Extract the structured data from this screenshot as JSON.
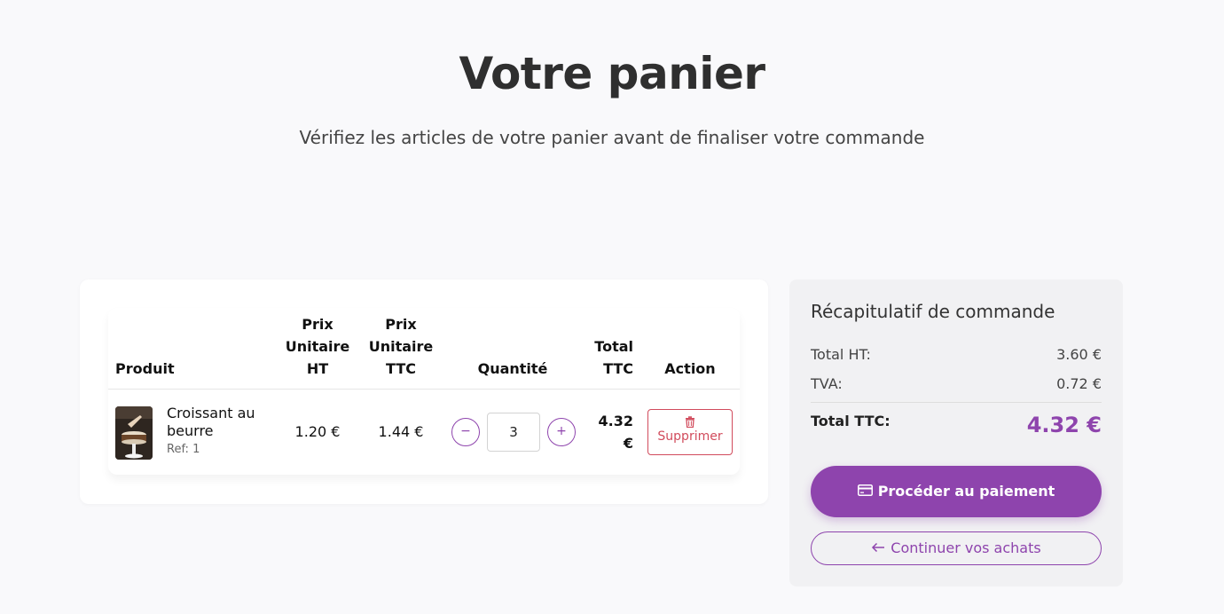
{
  "header": {
    "title": "Votre panier",
    "subtitle": "Vérifiez les articles de votre panier avant de finaliser votre commande"
  },
  "cart": {
    "columns": {
      "product": "Produit",
      "unit_ht_1": "Prix",
      "unit_ht_2": "Unitaire",
      "unit_ht_3": "HT",
      "unit_ttc_1": "Prix",
      "unit_ttc_2": "Unitaire",
      "unit_ttc_3": "TTC",
      "quantity": "Quantité",
      "total_1": "Total",
      "total_2": "TTC",
      "action": "Action"
    },
    "items": [
      {
        "name": "Croissant au beurre",
        "ref": "Ref: 1",
        "unit_ht": "1.20 €",
        "unit_ttc": "1.44 €",
        "quantity": "3",
        "decrement": "−",
        "increment": "+",
        "total_1": "4.32",
        "total_2": "€",
        "delete_label": "Supprimer"
      }
    ]
  },
  "summary": {
    "title": "Récapitulatif de commande",
    "total_ht_label": "Total HT:",
    "total_ht_value": "3.60 €",
    "tva_label": "TVA:",
    "tva_value": "0.72 €",
    "total_ttc_label": "Total TTC:",
    "total_ttc_value": "4.32 €",
    "pay_button": "Procéder au paiement",
    "continue_button": "Continuer vos achats"
  },
  "colors": {
    "accent": "#8e44ad",
    "danger": "#d14b5c"
  },
  "icons": {
    "pay": "credit-card-icon",
    "continue": "arrow-left-icon",
    "delete": "trash-icon"
  }
}
